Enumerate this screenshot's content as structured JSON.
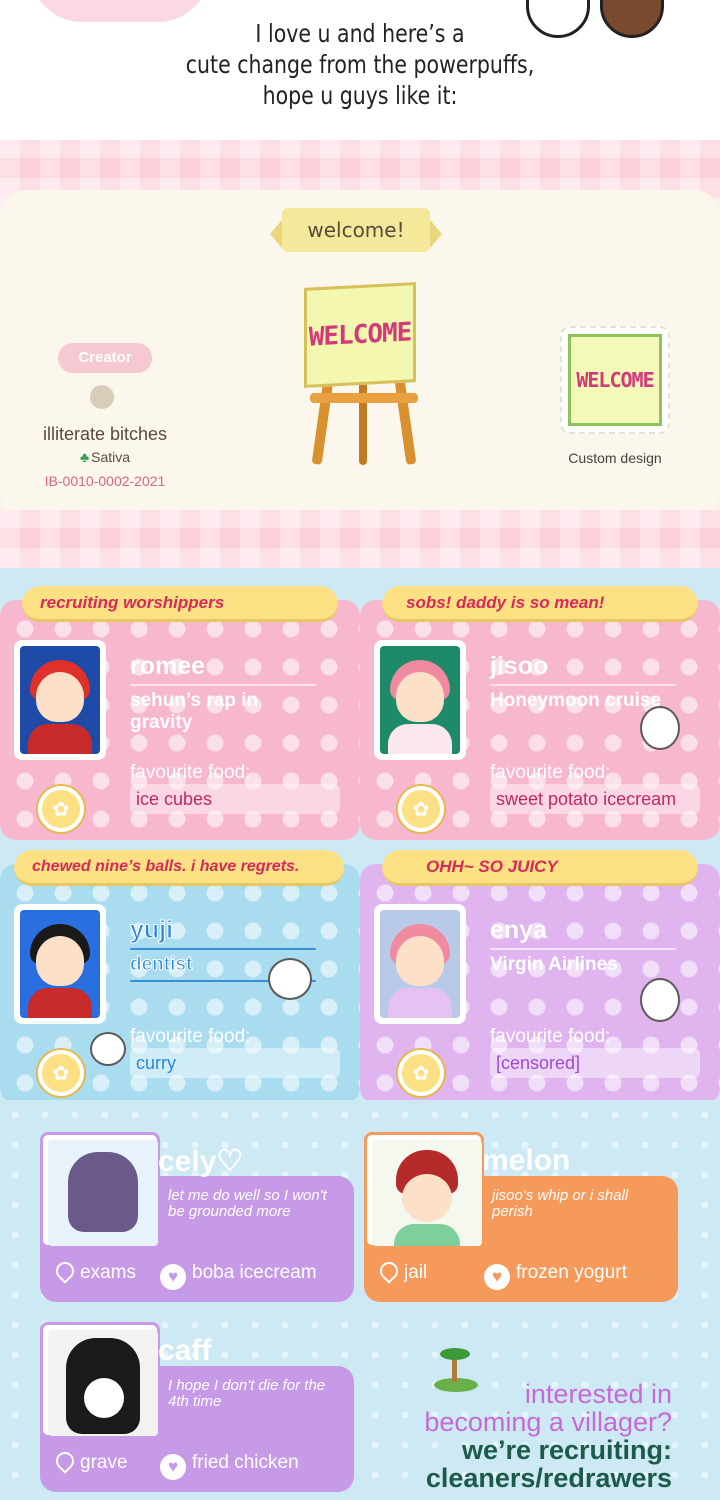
{
  "intro": {
    "line1": "I love u and here’s a",
    "line2": "cute change from the powerpuffs,",
    "line3": "hope u guys like it:"
  },
  "design": {
    "banner": "welcome!",
    "sign_text": "WELCOME",
    "creator_label": "Creator",
    "creator_name": "illiterate bitches",
    "island": "Sativa",
    "creator_code": "IB-0010-0002-2021",
    "thumb_caption": "Custom design"
  },
  "cards": [
    {
      "ribbon": "recruiting worshippers",
      "name": "romee",
      "job": "sehun’s rap in gravity",
      "food_label": "favourite food:",
      "food": "ice cubes",
      "hair_color": "#e0302a",
      "bg_color": "#1e4aa8",
      "shirt_color": "#c92a2a"
    },
    {
      "ribbon": "sobs! daddy is so mean!",
      "name": "jisoo",
      "job": "Honeymoon cruise",
      "food_label": "favourite food:",
      "food": "sweet potato icecream",
      "hair_color": "#f08aa0",
      "bg_color": "#1f8a6a",
      "shirt_color": "#fbe8ee"
    },
    {
      "ribbon": "chewed nine’s balls. i have regrets.",
      "name": "yuji",
      "job": "dentist",
      "food_label": "favourite food:",
      "food": "curry",
      "hair_color": "#1a1a1a",
      "bg_color": "#2a6fe0",
      "shirt_color": "#c92a2a"
    },
    {
      "ribbon": "OHH~ SO JUICY",
      "name": "enya",
      "job": "Virgin Airlines",
      "food_label": "favourite food:",
      "food": "[censored]",
      "hair_color": "#f08aa0",
      "bg_color": "#b9c9e8",
      "shirt_color": "#e6c2f2"
    }
  ],
  "roster": [
    {
      "name": "cely",
      "name_suffix": "♡",
      "quote": "let me do well so I won't be grounded more",
      "location": "exams",
      "favourite": "boba icecream"
    },
    {
      "name": "melon",
      "name_suffix": "",
      "quote": "jisoo's whip or i shall perish",
      "location": "jail",
      "favourite": "frozen yogurt"
    },
    {
      "name": "caff",
      "name_suffix": "",
      "quote": "I hope I don't die for the 4th time",
      "location": "grave",
      "favourite": "fried chicken"
    }
  ],
  "recruit": {
    "line1": "interested in",
    "line2": "becoming a villager?",
    "line3": "we’re recruiting:",
    "line4": "cleaners/redrawers"
  },
  "colors": {
    "pink_card": "#f7b7cf",
    "blue_card": "#a9dcef",
    "purple_card": "#e0b5ef",
    "ribbon": "#fbe183",
    "roster_purple": "#c79ae8",
    "roster_orange": "#f59a5a"
  }
}
